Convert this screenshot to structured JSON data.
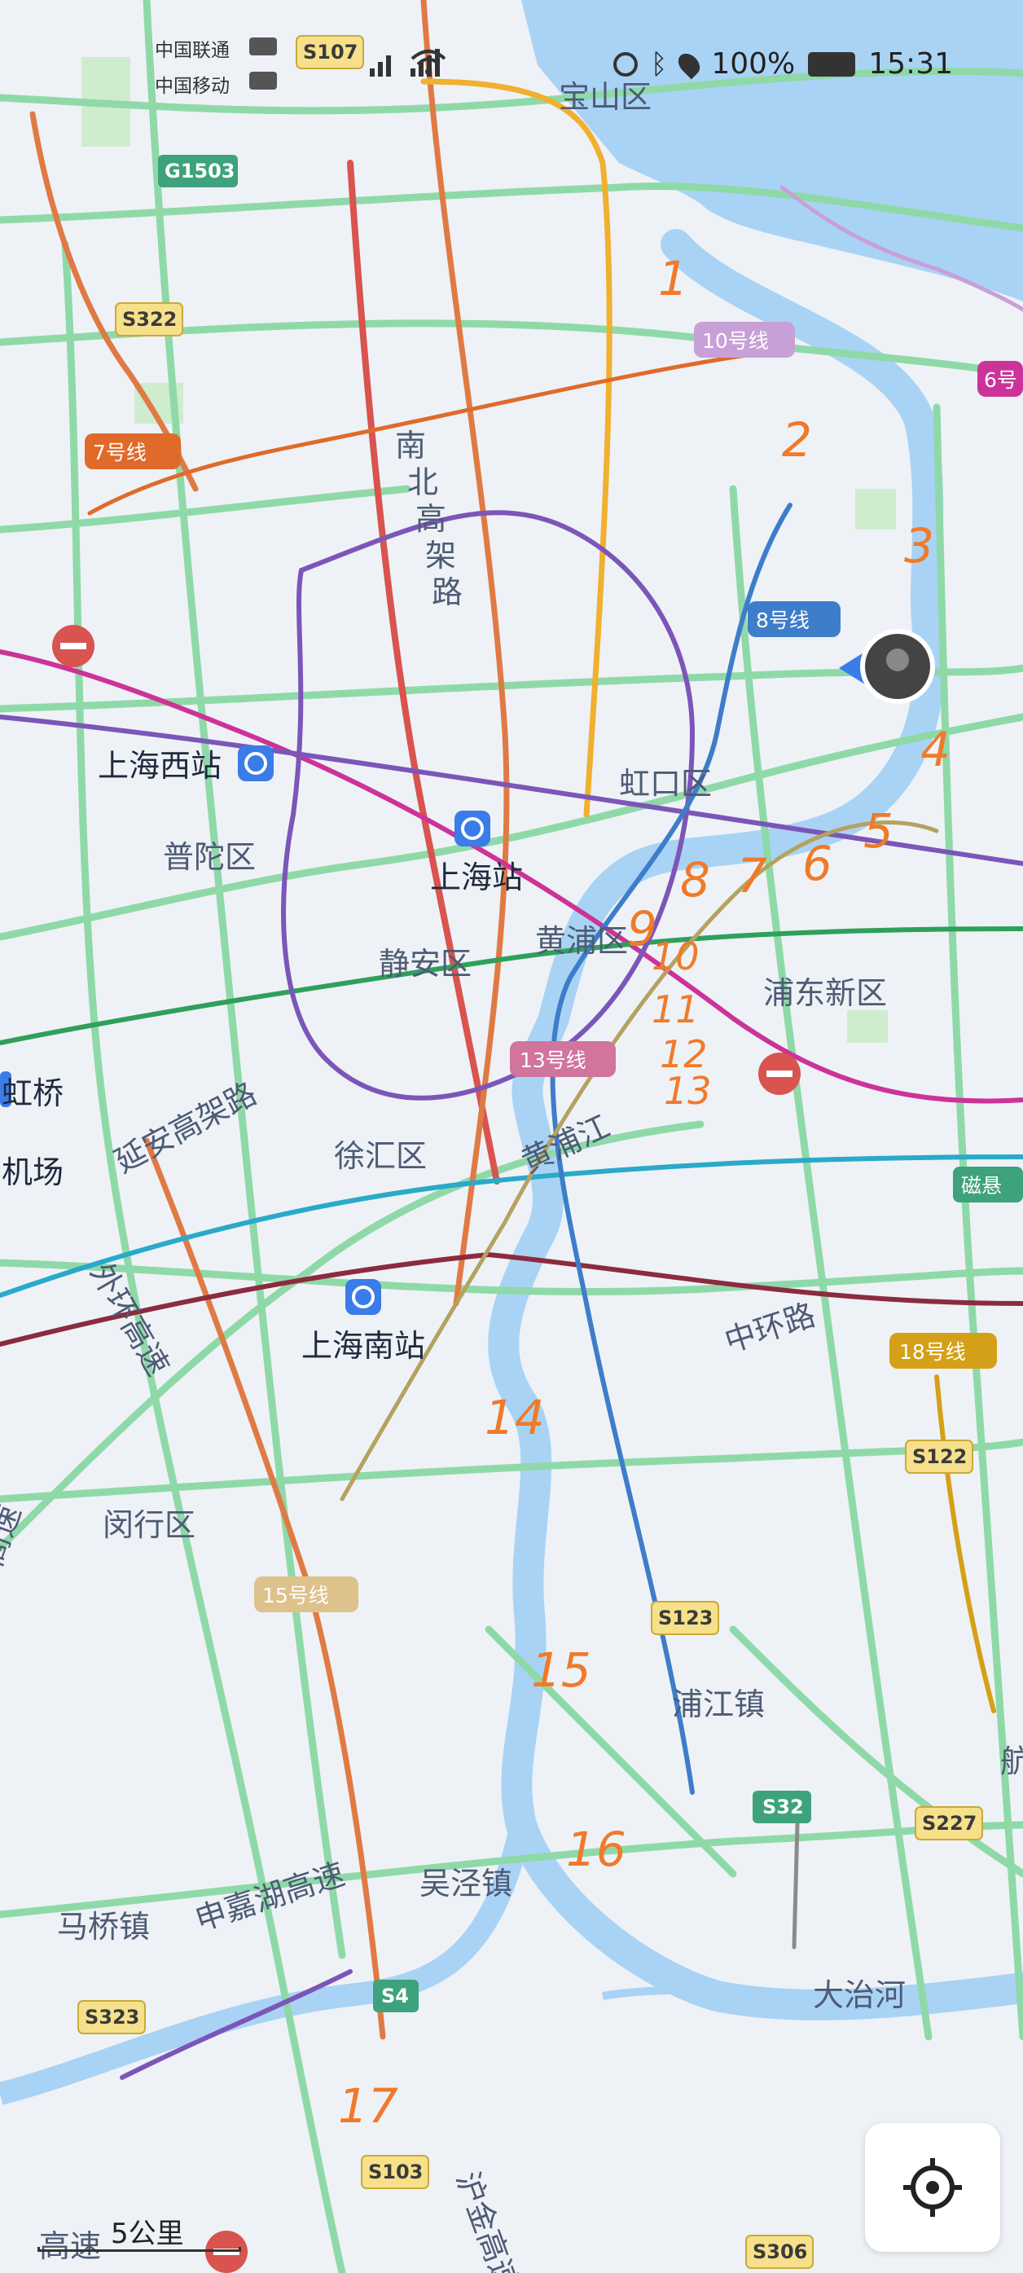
{
  "status_bar": {
    "carrier_1": "中国联通",
    "carrier_2": "中国移动",
    "battery": "100%",
    "time": "15:31"
  },
  "districts": {
    "baoshan": "宝山区",
    "hongkou": "虹口区",
    "putuo": "普陀区",
    "jingan": "静安区",
    "huangpu": "黄浦区",
    "pudong": "浦东新区",
    "xuhui": "徐汇区",
    "minhang": "闵行区"
  },
  "stations": {
    "shanghai_west": "上海西站",
    "shanghai": "上海站",
    "shanghai_south": "上海南站",
    "hongqiao_1": "虹桥",
    "hongqiao_2": "机场"
  },
  "roads": {
    "nanbei_1": "南",
    "nanbei_2": "北",
    "nanbei_3": "高",
    "nanbei_4": "架",
    "nanbei_5": "路",
    "yanan": "延安高架路",
    "waihuan": "外环高速",
    "zhonghuan": "中环路",
    "huangpu_river": "黄浦江",
    "shenjiahu": "申嘉湖高速",
    "hujin": "沪金高速",
    "gaosu_left": "高速",
    "gaosu_bottom": "高速",
    "cizhou": "磁悬",
    "hang": "航头",
    "dazhi": "大治河"
  },
  "towns": {
    "pujiang": "浦江镇",
    "wujing": "吴泾镇",
    "maqiao": "马桥镇"
  },
  "shields": {
    "g1503": "G1503",
    "s107": "S107",
    "s322": "S322",
    "s122": "S122",
    "s123": "S123",
    "s32": "S32",
    "s227": "S227",
    "s4": "S4",
    "s323": "S323",
    "s103": "S103",
    "s306": "S306"
  },
  "metro_badges": {
    "line10": "10号线",
    "line6": "6号",
    "line7": "7号线",
    "line8": "8号线",
    "line13": "13号线",
    "line18": "18号线",
    "line15": "15号线"
  },
  "annotations": [
    "1",
    "2",
    "3",
    "4",
    "5",
    "6",
    "7",
    "8",
    "9",
    "10",
    "11",
    "12",
    "13",
    "14",
    "15",
    "16",
    "17"
  ],
  "scale": {
    "label": "5公里"
  },
  "colors": {
    "water": "#a9d3f5",
    "land": "#eef2f6",
    "expressway": "#8fd9a8",
    "handwriting": "#f07a2a"
  }
}
